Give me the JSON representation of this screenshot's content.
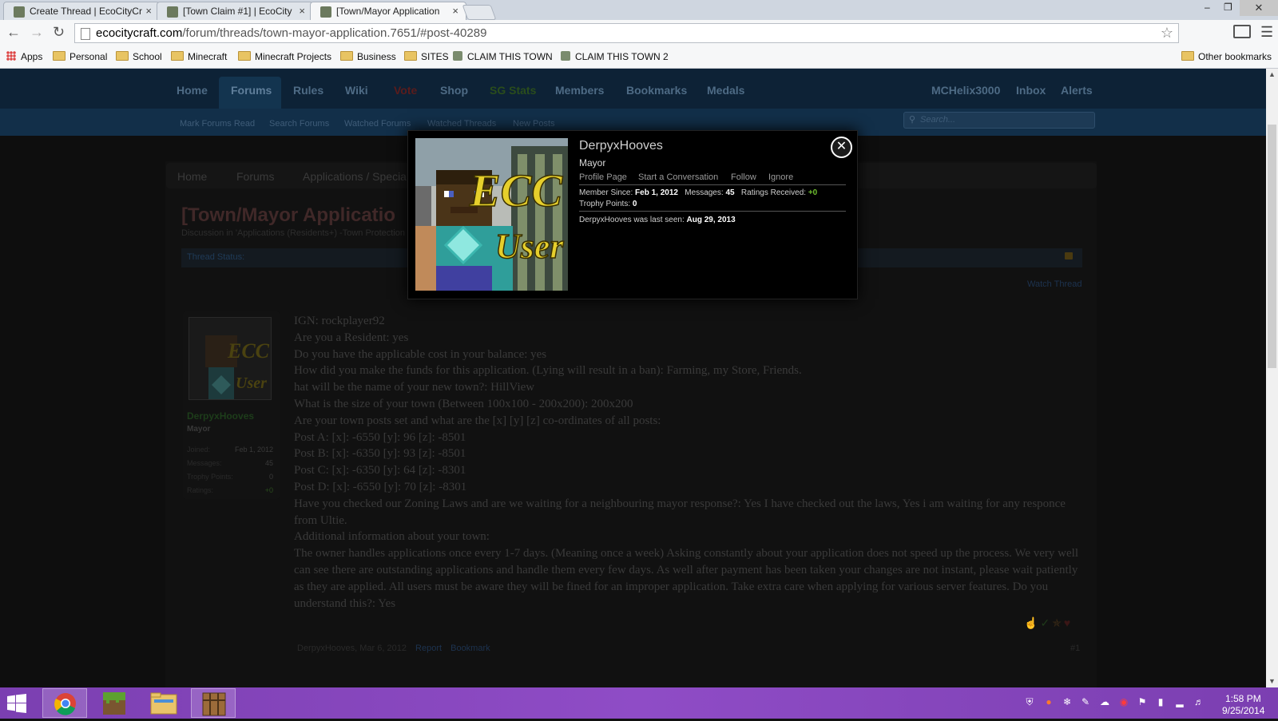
{
  "browser": {
    "tabs": [
      {
        "title": "Create Thread | EcoCityCr",
        "close": "×"
      },
      {
        "title": "[Town Claim #1] | EcoCity",
        "close": "×"
      },
      {
        "title": "[Town/Mayor Application",
        "close": "×"
      }
    ],
    "window_controls": {
      "minimize": "–",
      "restore": "❐",
      "close": "✕"
    },
    "url_host": "ecocitycraft.com",
    "url_path": "/forum/threads/town-mayor-application.7651/#post-40289",
    "bookmarks": [
      "Apps",
      "Personal",
      "School",
      "Minecraft",
      "Minecraft Projects",
      "Business",
      "SITES",
      "CLAIM THIS TOWN",
      "CLAIM THIS TOWN 2"
    ],
    "other_bookmarks": "Other bookmarks"
  },
  "nav": {
    "tabs": [
      "Home",
      "Forums",
      "Rules",
      "Wiki",
      "Vote",
      "Shop",
      "SG Stats",
      "Members",
      "Bookmarks",
      "Medals"
    ],
    "account": [
      "MCHelix3000",
      "Inbox",
      "Alerts"
    ],
    "sub_links": [
      "Mark Forums Read",
      "Search Forums",
      "Watched Forums",
      "Watched Threads",
      "New Posts"
    ],
    "search_placeholder": "Search..."
  },
  "breadcrumb": [
    "Home",
    "Forums",
    "Applications / Specia"
  ],
  "thread": {
    "title": "[Town/Mayor Applicatio",
    "subtitle": "Discussion in 'Applications (Residents+) -Town Protection",
    "status_label": "Thread Status:",
    "watch": "Watch Thread"
  },
  "author": {
    "name": "DerpyxHooves",
    "role": "Mayor",
    "stats": [
      {
        "label": "Joined:",
        "value": "Feb 1, 2012"
      },
      {
        "label": "Messages:",
        "value": "45"
      },
      {
        "label": "Trophy Points:",
        "value": "0"
      },
      {
        "label": "Ratings:",
        "value": "+0"
      }
    ]
  },
  "post": {
    "lines": [
      "IGN: rockplayer92",
      "Are you a Resident: yes",
      "Do you have the applicable cost in your balance: yes",
      "How did you make the funds for this application. (Lying will result in a ban): Farming, my Store, Friends.",
      "hat will be the name of your new town?: HillView",
      "What is the size of your town (Between 100x100 - 200x200): 200x200",
      "Are your town posts set and what are the [x] [y] [z] co-ordinates of all posts:",
      "Post A: [x]: -6550 [y]: 96 [z]: -8501",
      "Post B: [x]: -6350 [y]: 93 [z]: -8501",
      "Post C: [x]: -6350 [y]: 64 [z]: -8301",
      "Post D: [x]: -6550 [y]: 70 [z]: -8301",
      "Have you checked our Zoning Laws and are we waiting for a neighbouring mayor response?: Yes I have checked out the laws, Yes i am waiting for any responce from Ultie.",
      "Additional information about your town:",
      "The owner handles applications once every 1-7 days. (Meaning once a week) Asking constantly about your application does not speed up the process. We very well can see there are outstanding applications and handle them every few days. As well after payment has been taken your changes are not instant, please wait patiently as they are applied. All users must be aware they will be fined for an improper application. Take extra care when applying for various server features. Do you understand this?: Yes"
    ],
    "footer_author": "DerpyxHooves, Mar 6, 2012",
    "report": "Report",
    "bookmark": "Bookmark",
    "number": "#1"
  },
  "popup": {
    "name": "DerpyxHooves",
    "role": "Mayor",
    "links": [
      "Profile Page",
      "Start a Conversation",
      "Follow",
      "Ignore"
    ],
    "member_since_label": "Member Since:",
    "member_since": "Feb 1, 2012",
    "messages_label": "Messages:",
    "messages": "45",
    "ratings_label": "Ratings Received:",
    "ratings": "+0",
    "trophy_label": "Trophy Points:",
    "trophy": "0",
    "last_seen_text": "DerpyxHooves was last seen:",
    "last_seen": "Aug 29, 2013",
    "avatar_text_1": "ECC",
    "avatar_text_2": "User",
    "close_glyph": "✕"
  },
  "taskbar": {
    "time": "1:58 PM",
    "date": "9/25/2014"
  },
  "colors": {
    "navbar": "#0d2236",
    "subnav": "#122f49",
    "taskbar": "#8f4cc6",
    "ratings_green": "#6fbf2f"
  }
}
